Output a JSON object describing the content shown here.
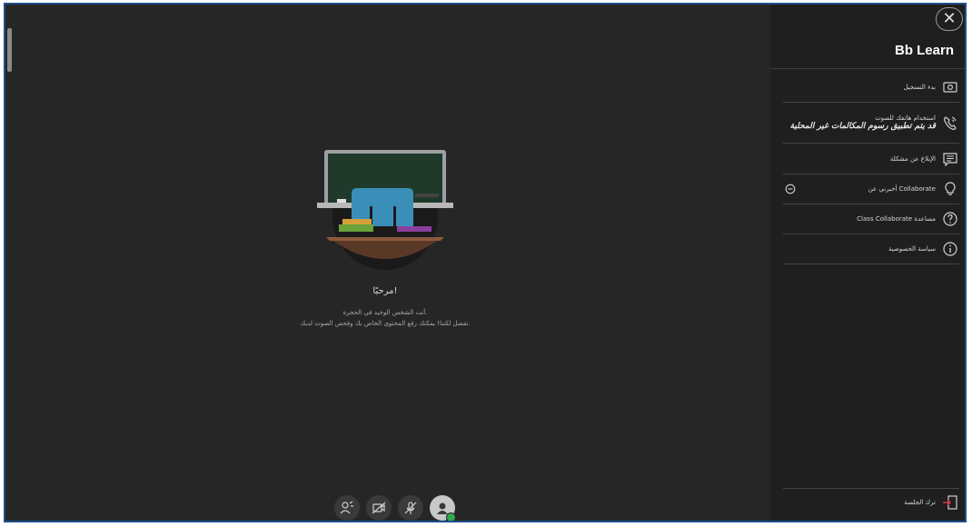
{
  "panel": {
    "title": "Bb Learn",
    "close_icon": "close-icon",
    "items": [
      {
        "label": "بدء التسجيل",
        "icon": "record-icon"
      },
      {
        "label": "استخدام هاتفك للصوت",
        "sublabel": "قد يتم تطبيق رسوم المكالمات غير المحلية",
        "icon": "phone-icon"
      },
      {
        "label": "الإبلاغ عن مشكلة",
        "icon": "report-icon"
      },
      {
        "label": "أخبرني عن Collaborate",
        "icon": "lightbulb-icon"
      },
      {
        "label": "Class Collaborate مساعدة",
        "icon": "help-icon"
      },
      {
        "label": "سياسة الخصوصية",
        "icon": "info-icon"
      }
    ],
    "leave_label": "ترك الجلسة"
  },
  "welcome": {
    "title": "مرحبًا!",
    "line1": "أنت الشخص الوحيد في الحجرة.",
    "line2": "تفضل لكننا! يمكنك رفع المحتوى الخاص بك وفحص الصوت لديك."
  },
  "media_controls": [
    "share-icon",
    "camera-off-icon",
    "mic-off-icon",
    "avatar"
  ],
  "colors": {
    "stage": "#262626",
    "panel": "#1f1f1f",
    "status_ok": "#2fa84f",
    "leave_icon": "#d9383a"
  }
}
